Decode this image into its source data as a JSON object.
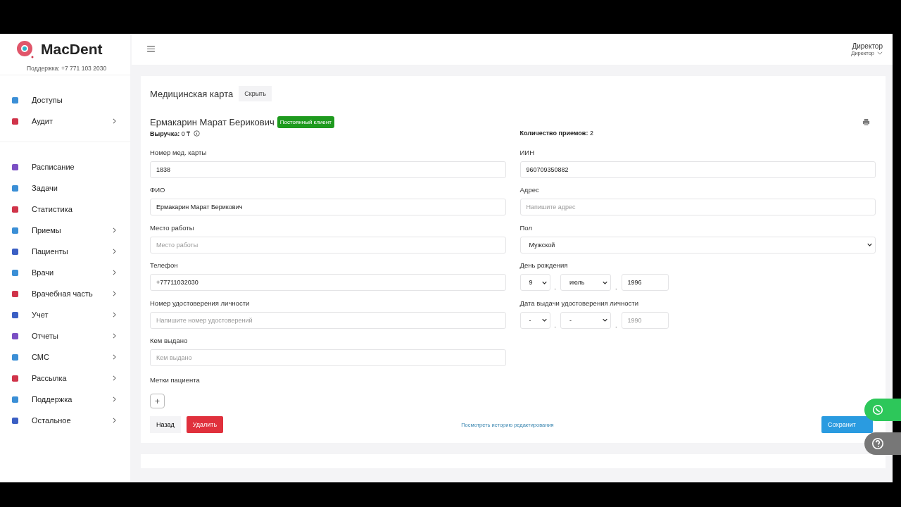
{
  "sidebar": {
    "logo": "MacDent",
    "support": "Поддержка: +7 771 103 2030",
    "groups": [
      [
        {
          "label": "Доступы",
          "color": "#3b8fd6",
          "expandable": false
        },
        {
          "label": "Аудит",
          "color": "#d0344a",
          "expandable": true
        }
      ],
      [
        {
          "label": "Расписание",
          "color": "#7b4fc4",
          "expandable": false
        },
        {
          "label": "Задачи",
          "color": "#3b8fd6",
          "expandable": false
        },
        {
          "label": "Статистика",
          "color": "#d0344a",
          "expandable": false
        },
        {
          "label": "Приемы",
          "color": "#3b8fd6",
          "expandable": true
        },
        {
          "label": "Пациенты",
          "color": "#3b5fc4",
          "expandable": true
        },
        {
          "label": "Врачи",
          "color": "#3b8fd6",
          "expandable": true
        },
        {
          "label": "Врачебная часть",
          "color": "#d0344a",
          "expandable": true
        },
        {
          "label": "Учет",
          "color": "#3b5fc4",
          "expandable": true
        },
        {
          "label": "Отчеты",
          "color": "#7b4fc4",
          "expandable": true
        },
        {
          "label": "СМС",
          "color": "#3b8fd6",
          "expandable": true
        },
        {
          "label": "Рассылка",
          "color": "#d0344a",
          "expandable": true
        },
        {
          "label": "Поддержка",
          "color": "#3b8fd6",
          "expandable": true
        },
        {
          "label": "Остальное",
          "color": "#3b5fc4",
          "expandable": true
        }
      ]
    ]
  },
  "header": {
    "user_name": "Директор",
    "user_role": "Директор"
  },
  "card": {
    "title": "Медицинская карта",
    "hide_button": "Скрыть",
    "patient": "Ермакарин Марат Берикович",
    "badge": "Постоянный клиент",
    "revenue_label": "Выручка:",
    "revenue": "0 ₸",
    "visits_label": "Количество приемов:",
    "visits": "2",
    "left_fields": [
      {
        "kind": "text",
        "label": "Номер мед. карты",
        "value": "1838"
      },
      {
        "kind": "text",
        "label": "ФИО",
        "value": "Ермакарин Марат Берикович"
      },
      {
        "kind": "text",
        "label": "Место работы",
        "placeholder": "Место работы"
      },
      {
        "kind": "text",
        "label": "Телефон",
        "value": "+77711032030"
      },
      {
        "kind": "text",
        "label": "Номер удостоверения личности",
        "placeholder": "Напишите номер удостоверений"
      },
      {
        "kind": "text",
        "label": "Кем выдано",
        "placeholder": "Кем выдано"
      }
    ],
    "right_fields": [
      {
        "kind": "text",
        "label": "ИИН",
        "value": "960709350882"
      },
      {
        "kind": "text",
        "label": "Адрес",
        "placeholder": "Напишите адрес"
      },
      {
        "kind": "select",
        "label": "Пол",
        "value": "Мужской"
      },
      {
        "kind": "date",
        "label": "День рождения",
        "day": "9",
        "month": "июль",
        "year": "1996",
        "separators": [
          ".",
          "."
        ]
      },
      {
        "kind": "date",
        "label": "Дата выдачи удостоверения личности",
        "day": "-",
        "month": "-",
        "year_placeholder": "1990",
        "separators": [
          ".",
          "."
        ]
      }
    ],
    "tags_label": "Метки пациента",
    "add_tag": "+",
    "back_button": "Назад",
    "delete_button": "Удалить",
    "history_link": "Посмотреть историю редактирования",
    "save_button": "Сохранит"
  }
}
